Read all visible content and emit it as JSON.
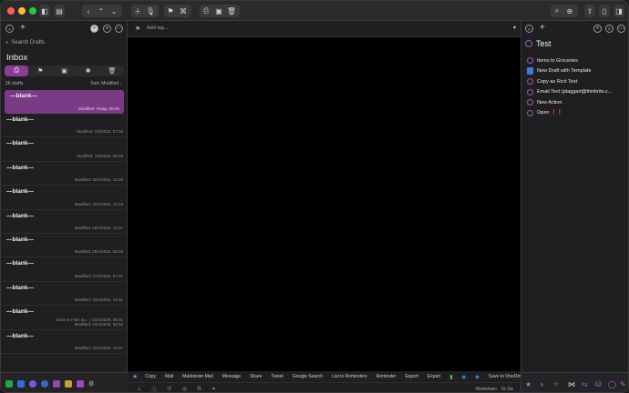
{
  "toolbar": {
    "buttons": [
      "sidebar-toggle",
      "back",
      "up",
      "down",
      "new",
      "dictate",
      "flag",
      "tag",
      "archive",
      "inbox",
      "trash",
      "search-zoom",
      "share-panel",
      "sidebar-toggle-right",
      "sidebar-right"
    ]
  },
  "left": {
    "search_placeholder": "Search Drafts",
    "title": "Inbox",
    "count_label": "26 drafts",
    "sort_label": "Sort: Modified ↓",
    "tabs": [
      "inbox",
      "flagged",
      "archive",
      "all",
      "trash"
    ],
    "drafts": [
      {
        "title": "—blank—",
        "meta": "Modified: Today, 08:00",
        "selected": true
      },
      {
        "title": "—blank—",
        "meta": "Modified: 2/5/2026, 07:04"
      },
      {
        "title": "—blank—",
        "meta": "Modified: 1/5/2026, 09:28"
      },
      {
        "title": "—blank—",
        "meta": "Modified: 30/4/2026, 10:35"
      },
      {
        "title": "—blank—",
        "meta": "Modified: 30/4/2026, 10:24"
      },
      {
        "title": "—blank—",
        "meta": "Modified: 28/4/2026, 12:37"
      },
      {
        "title": "—blank—",
        "meta": "Modified: 28/4/2026, 08:28"
      },
      {
        "title": "—blank—",
        "meta": "Modified: 27/4/2026, 07:01"
      },
      {
        "title": "—blank—",
        "meta": "Modified: 23/4/2026, 14:31"
      },
      {
        "title": "—blank—",
        "meta": "Save to Files au... | 23/4/2026, 08:01\nModified: 23/4/2026, 08:02"
      },
      {
        "title": "—blank—",
        "meta": "Modified: 22/4/2026, 15:37"
      }
    ]
  },
  "editor": {
    "tag_placeholder": "Add tag...",
    "actions": [
      "Copy",
      "Mail",
      "Markdown Mail",
      "Message",
      "Share",
      "Tweet",
      "Google Search",
      "List in Reminders",
      "Reminder",
      "Export",
      "Export",
      "Save to OneDrive"
    ],
    "mode": "Markdown",
    "word_count": "0c 0w"
  },
  "right": {
    "group_title": "Test",
    "actions": [
      {
        "label": "Items to Groceries",
        "icon": "ring"
      },
      {
        "label": "New Draft with Template",
        "icon": "doc-blue"
      },
      {
        "label": "Copy as Rich Text",
        "icon": "ring"
      },
      {
        "label": "Email Text (ptaggart@thinkrite.c...",
        "icon": "ring"
      },
      {
        "label": "New Action",
        "icon": "ring"
      },
      {
        "label": "Open ❗❗",
        "icon": "ring"
      }
    ]
  },
  "colors": {
    "accent": "#8a3d93",
    "selected_row": "#7b3a86",
    "ring": "#9c58b0"
  }
}
